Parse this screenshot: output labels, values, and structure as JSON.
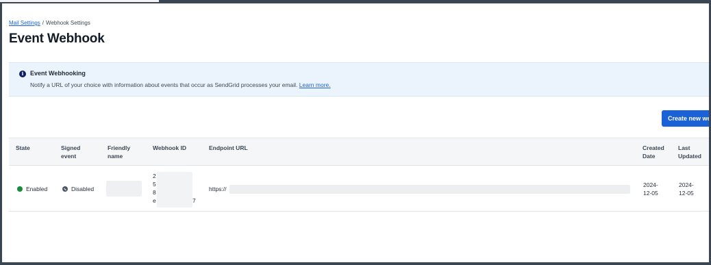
{
  "breadcrumb": {
    "parent": "Mail Settings",
    "separator": "/",
    "current": "Webhook Settings"
  },
  "page_title": "Event Webhook",
  "banner": {
    "title": "Event Webhooking",
    "text": "Notify a URL of your choice with information about events that occur as SendGrid processes your email.",
    "link": "Learn more.",
    "icon": "info-icon"
  },
  "create_button": "Create new webhook",
  "table": {
    "headers": {
      "state": "State",
      "signed_event_1": "Signed",
      "signed_event_2": "event",
      "friendly_name_1": "Friendly",
      "friendly_name_2": "name",
      "webhook_id": "Webhook ID",
      "endpoint_url": "Endpoint URL",
      "created_1": "Created",
      "created_2": "Date",
      "updated_1": "Last",
      "updated_2": "Updated"
    },
    "rows": [
      {
        "state": "Enabled",
        "signed_event": "Disabled",
        "friendly_name": "",
        "webhook_id_lines": [
          "2",
          "5",
          "8",
          "e",
          "7"
        ],
        "endpoint_url": "https://",
        "created_1": "2024-",
        "created_2": "12-05",
        "updated_1": "2024-",
        "updated_2": "12-05"
      }
    ]
  },
  "colors": {
    "accent": "#1a62d6",
    "enabled": "#1a8a3c",
    "disabled": "#4c5966",
    "banner_bg": "#ebf4fd"
  }
}
